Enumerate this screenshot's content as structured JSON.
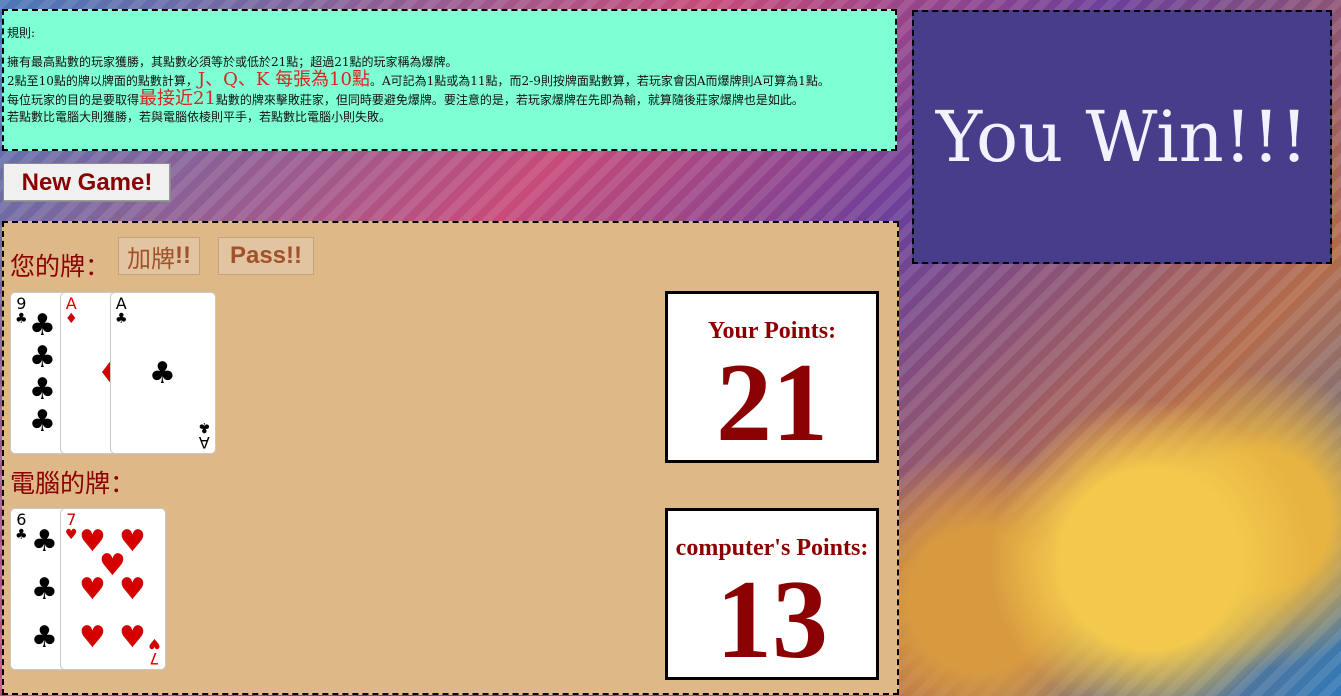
{
  "rules": {
    "heading": "規則:",
    "line1": "擁有最高點數的玩家獲勝，其點數必須等於或低於21點；超過21點的玩家稱為爆牌。",
    "line2_a": "2點至10點的牌以牌面的點數計算，",
    "line2_hl": "J、Q、K 每張為10點",
    "line2_b": "。A可記為1點或為11點，而2-9則按牌面點數算，若玩家會因A而爆牌則A可算為1點。",
    "line3_a": "每位玩家的目的是要取得",
    "line3_hl": "最接近21",
    "line3_b": "點數的牌來擊敗莊家，但同時要避免爆牌。要注意的是，若玩家爆牌在先即為輸，就算隨後莊家爆牌也是如此。",
    "line4": "若點數比電腦大則獲勝，若與電腦依棱則平手，若點數比電腦小則失敗。"
  },
  "result": {
    "text": "You Win!!!"
  },
  "controls": {
    "new_game": "New Game!",
    "hit_text": "加牌",
    "hit_bang": "!!",
    "pass": "Pass!!"
  },
  "player": {
    "label": "您的牌：",
    "points_title": "Your Points:",
    "points": "21",
    "cards": [
      {
        "rank": "9",
        "suit": "♣",
        "color": "#000000"
      },
      {
        "rank": "A",
        "suit": "♦",
        "color": "#d40000"
      },
      {
        "rank": "A",
        "suit": "♣",
        "color": "#000000"
      }
    ]
  },
  "computer": {
    "label": "電腦的牌：",
    "points_title": "computer's Points:",
    "points": "13",
    "cards": [
      {
        "rank": "6",
        "suit": "♣",
        "color": "#000000"
      },
      {
        "rank": "7",
        "suit": "♥",
        "color": "#d40000"
      }
    ]
  }
}
